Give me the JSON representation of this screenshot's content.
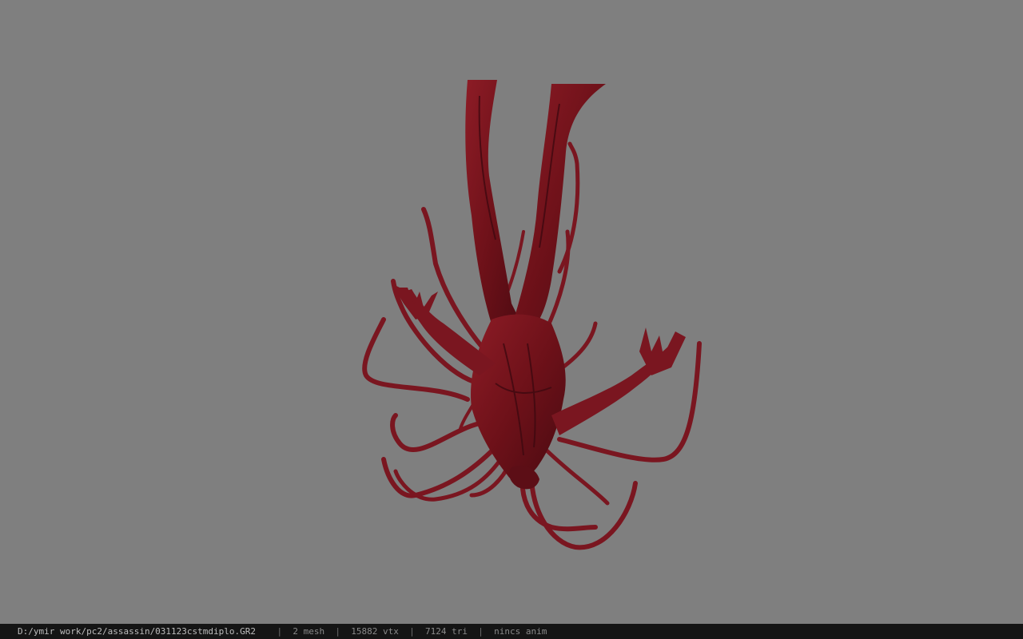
{
  "viewport": {
    "background": "#7f7f7f",
    "model_color": "#7a1620",
    "model_shadow": "#3e0910"
  },
  "status": {
    "file_path": "D:/ymir work/pc2/assassin/031123cstmdiplo.GR2",
    "separator": "|",
    "mesh": "2 mesh",
    "vertices": "15882 vtx",
    "triangles": "7124 tri",
    "animation": "nincs anim"
  }
}
